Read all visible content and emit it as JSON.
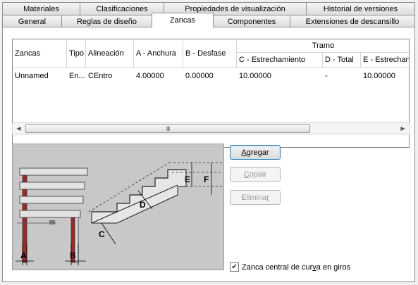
{
  "tabs_row1": [
    {
      "label": "Materiales"
    },
    {
      "label": "Clasificaciones"
    },
    {
      "label": "Propiedades de visualización"
    },
    {
      "label": "Historial de versiones"
    }
  ],
  "tabs_row2": [
    {
      "label": "General"
    },
    {
      "label": "Reglas de diseño"
    },
    {
      "label": "Zancas",
      "active": true
    },
    {
      "label": "Componentes"
    },
    {
      "label": "Extensiones de descansillo"
    }
  ],
  "grid": {
    "group_header": "Tramo",
    "columns": [
      "Zancas",
      "Tipo",
      "Alineación",
      "A - Anchura",
      "B - Desfase",
      "C - Estrechamiento",
      "D - Total",
      "E - Estrechan"
    ],
    "rows": [
      [
        "Unnamed",
        "En...",
        "CEntro",
        "4.00000",
        "0.00000",
        "10.00000",
        "-",
        "10.00000"
      ]
    ]
  },
  "scrollbar": {
    "thumb_glyph": "III"
  },
  "illustration": {
    "labels": [
      "A",
      "B",
      "C",
      "D",
      "E",
      "F"
    ]
  },
  "buttons": {
    "add": {
      "pre": "",
      "accel": "A",
      "post": "gregar"
    },
    "copy": {
      "pre": "",
      "accel": "C",
      "post": "opiar"
    },
    "delete": {
      "pre": "Elimina",
      "accel": "r",
      "post": ""
    }
  },
  "checkbox": {
    "pre": "Zanca central de cur",
    "accel": "v",
    "post": "a en giros",
    "checked": true
  }
}
